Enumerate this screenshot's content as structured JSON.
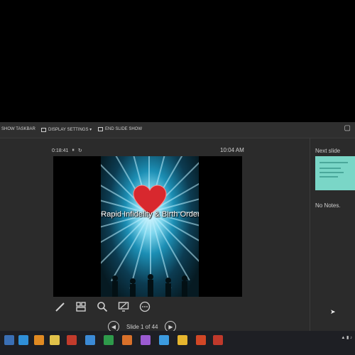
{
  "toolbar": {
    "show_taskbar": "SHOW TASKBAR",
    "display_settings": "DISPLAY SETTINGS ▾",
    "end_slide_show": "END SLIDE SHOW"
  },
  "timer": {
    "elapsed": "0:18:41"
  },
  "clock": {
    "time": "10:04 AM"
  },
  "slide": {
    "title": "Rapid Infidelity & Birth Order"
  },
  "navigation": {
    "counter": "Slide 1 of 44"
  },
  "next_slide": {
    "label": "Next slide"
  },
  "notes": {
    "text": "No Notes."
  },
  "icons": {
    "pen": "pen-icon",
    "slides": "slides-grid-icon",
    "zoom": "zoom-icon",
    "screen": "black-screen-icon",
    "more": "more-options-icon"
  },
  "colors": {
    "panel_bg": "#2b2b2b",
    "next_thumb": "#7ad6c7",
    "heart": "#d8282e"
  }
}
